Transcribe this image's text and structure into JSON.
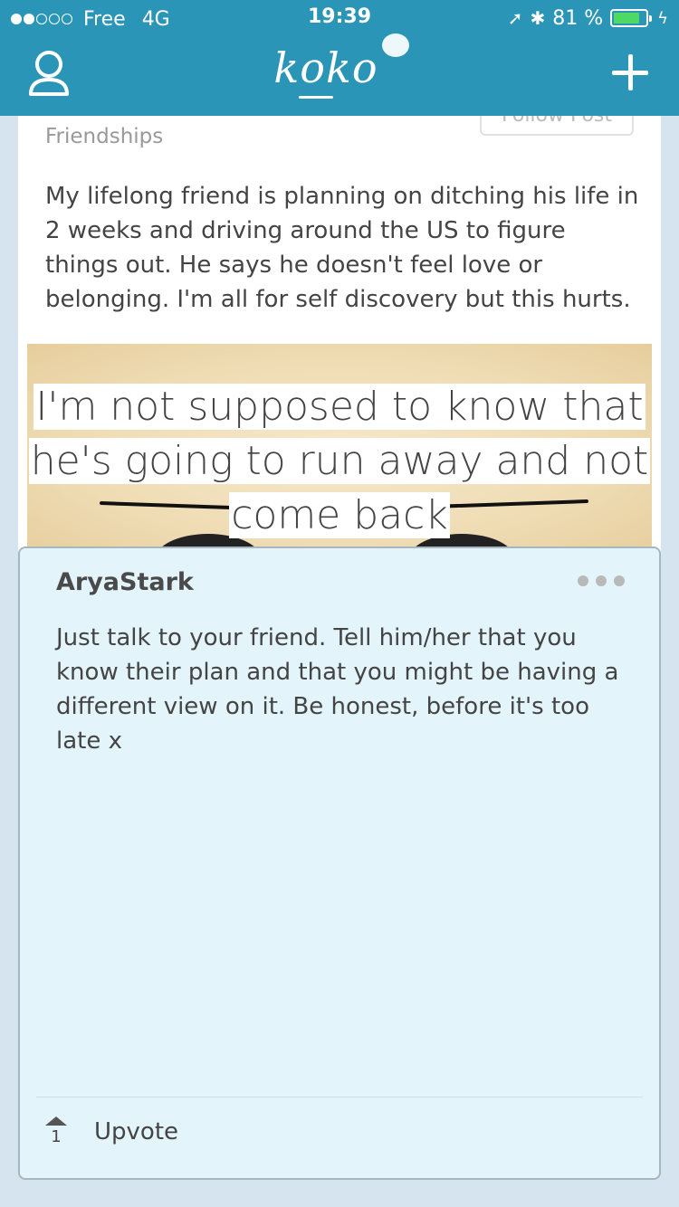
{
  "status_bar": {
    "carrier": "Free",
    "network": "4G",
    "signal_filled": 2,
    "signal_total": 5,
    "time": "19:39",
    "battery": "81 %",
    "battery_fraction": 0.81,
    "battery_color": "#4cd964"
  },
  "header": {
    "logo": "koko",
    "background": "#2a95b6"
  },
  "post": {
    "follow_label": "Follow Post",
    "category": "Friendships",
    "text": "My lifelong friend is planning on ditching his life in 2 weeks and driving around the US to figure things out. He says he doesn't feel love or belonging. I'm all for self discovery but this hurts.",
    "image_quote": "I'm not supposed to know that he's going to run away and not come back"
  },
  "reply": {
    "author": "AryaStark",
    "text": "Just talk to your friend. Tell him/her that you know their plan and that you might be having a different view on it. Be honest, before it's too late x",
    "upvote_count": "1",
    "upvote_label": "Upvote",
    "background": "#e3f4fb"
  }
}
